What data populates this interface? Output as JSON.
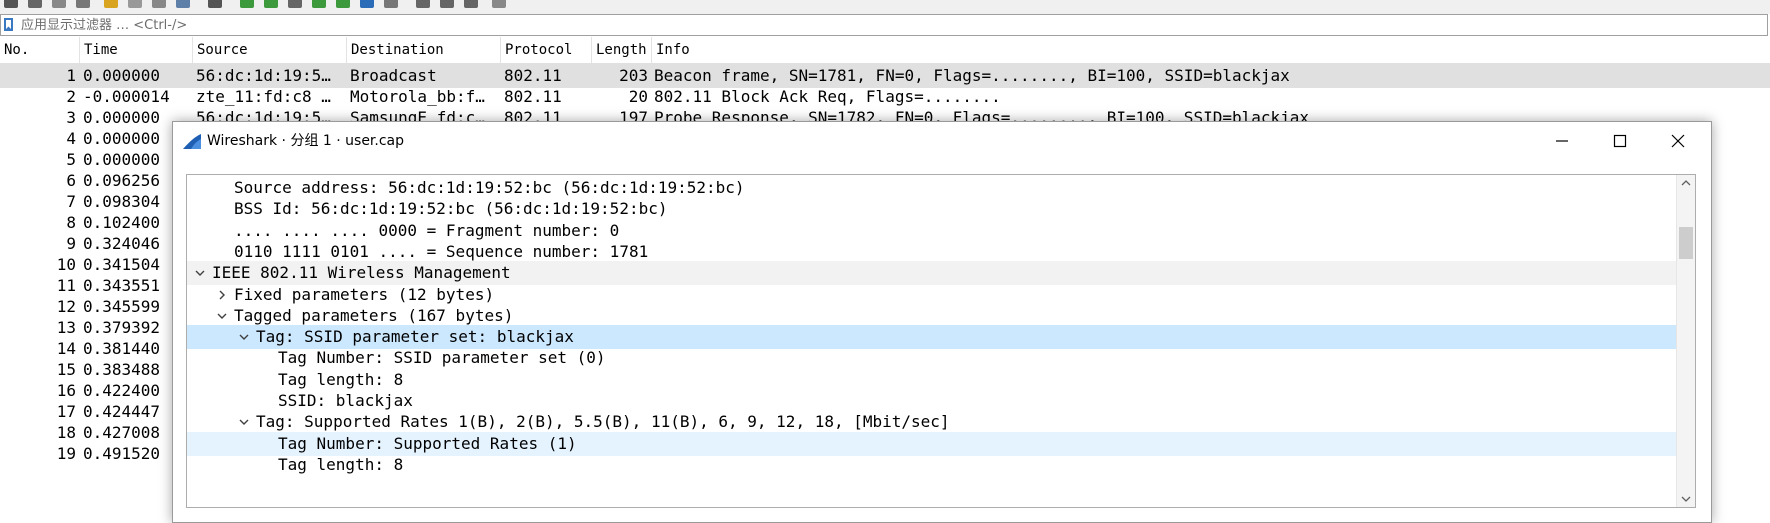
{
  "toolbar": {
    "icons": [
      "stop-capture-icon",
      "restart-capture-icon",
      "capture-options-icon",
      "reload-icon",
      "open-file-icon",
      "save-file-icon",
      "close-file-icon",
      "reload-file-icon",
      "find-packet-icon",
      "go-back-icon",
      "go-forward-icon",
      "go-to-packet-icon",
      "go-first-icon",
      "go-last-icon",
      "auto-scroll-icon",
      "colorize-icon",
      "zoom-in-icon",
      "zoom-out-icon",
      "zoom-reset-icon",
      "resize-columns-icon"
    ]
  },
  "filter": {
    "placeholder": "应用显示过滤器 … <Ctrl-/>",
    "value": ""
  },
  "packet_list": {
    "columns": [
      "No.",
      "Time",
      "Source",
      "Destination",
      "Protocol",
      "Length",
      "Info"
    ],
    "rows": [
      {
        "no": "1",
        "time": "0.000000",
        "source": "56:dc:1d:19:5…",
        "destination": "Broadcast",
        "protocol": "802.11",
        "length": "203",
        "info": "Beacon frame, SN=1781, FN=0, Flags=........, BI=100, SSID=blackjax"
      },
      {
        "no": "2",
        "time": "-0.000014",
        "source": "zte_11:fd:c8 …",
        "destination": "Motorola_bb:f…",
        "protocol": "802.11",
        "length": "20",
        "info": "802.11 Block Ack Req, Flags=........"
      },
      {
        "no": "3",
        "time": "0.000000",
        "source": "56:dc:1d:19:5…",
        "destination": "SamsungE_fd:c…",
        "protocol": "802.11",
        "length": "197",
        "info": "Probe Response, SN=1782, FN=0, Flags=........, BI=100, SSID=blackjax"
      },
      {
        "no": "4",
        "time": "0.000000"
      },
      {
        "no": "5",
        "time": "0.000000"
      },
      {
        "no": "6",
        "time": "0.096256"
      },
      {
        "no": "7",
        "time": "0.098304"
      },
      {
        "no": "8",
        "time": "0.102400"
      },
      {
        "no": "9",
        "time": "0.324046"
      },
      {
        "no": "10",
        "time": "0.341504"
      },
      {
        "no": "11",
        "time": "0.343551"
      },
      {
        "no": "12",
        "time": "0.345599"
      },
      {
        "no": "13",
        "time": "0.379392"
      },
      {
        "no": "14",
        "time": "0.381440"
      },
      {
        "no": "15",
        "time": "0.383488"
      },
      {
        "no": "16",
        "time": "0.422400"
      },
      {
        "no": "17",
        "time": "0.424447"
      },
      {
        "no": "18",
        "time": "0.427008"
      },
      {
        "no": "19",
        "time": "0.491520"
      }
    ]
  },
  "dialog": {
    "title": "Wireshark · 分组 1 · user.cap",
    "tree": [
      {
        "text": "Source address: 56:dc:1d:19:52:bc (56:dc:1d:19:52:bc)",
        "depth": 1,
        "arrow": "none",
        "style": ""
      },
      {
        "text": "BSS Id: 56:dc:1d:19:52:bc (56:dc:1d:19:52:bc)",
        "depth": 1,
        "arrow": "none",
        "style": ""
      },
      {
        "text": ".... .... .... 0000 = Fragment number: 0",
        "depth": 1,
        "arrow": "none",
        "style": ""
      },
      {
        "text": "0110 1111 0101 .... = Sequence number: 1781",
        "depth": 1,
        "arrow": "none",
        "style": ""
      },
      {
        "text": "IEEE 802.11 Wireless Management",
        "depth": 0,
        "arrow": "down",
        "style": "grp"
      },
      {
        "text": "Fixed parameters (12 bytes)",
        "depth": 1,
        "arrow": "right",
        "style": ""
      },
      {
        "text": "Tagged parameters (167 bytes)",
        "depth": 1,
        "arrow": "down",
        "style": ""
      },
      {
        "text": "Tag: SSID parameter set: blackjax",
        "depth": 2,
        "arrow": "down",
        "style": "hl"
      },
      {
        "text": "Tag Number: SSID parameter set (0)",
        "depth": 3,
        "arrow": "none",
        "style": ""
      },
      {
        "text": "Tag length: 8",
        "depth": 3,
        "arrow": "none",
        "style": ""
      },
      {
        "text": "SSID: blackjax",
        "depth": 3,
        "arrow": "none",
        "style": ""
      },
      {
        "text": "Tag: Supported Rates 1(B), 2(B), 5.5(B), 11(B), 6, 9, 12, 18, [Mbit/sec]",
        "depth": 2,
        "arrow": "down",
        "style": ""
      },
      {
        "text": "Tag Number: Supported Rates (1)",
        "depth": 3,
        "arrow": "none",
        "style": "hv"
      },
      {
        "text": "Tag length: 8",
        "depth": 3,
        "arrow": "none",
        "style": ""
      }
    ]
  },
  "colors": {
    "selected_row": "#e0e0e0",
    "tree_highlight": "#cce8ff",
    "tree_hover": "#e5f3ff",
    "wireshark_fin": "#1e5fb4"
  }
}
